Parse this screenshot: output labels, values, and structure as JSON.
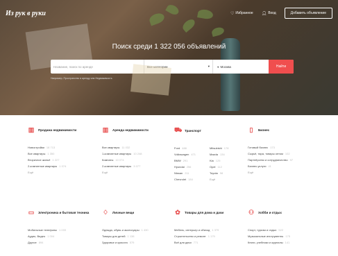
{
  "header": {
    "logo": "Из рук в руки",
    "favorites": "Избранное",
    "login": "Вход",
    "post_ad": "Добавить объявление",
    "favorites_icon": "heart-icon",
    "login_icon": "user-icon"
  },
  "hero": {
    "headline": "Поиск среди 1 322 056 объявлений",
    "search_placeholder": "Название, поиск по аренде",
    "category_selected": "Все категории",
    "location": "Москва",
    "search_button": "Найти",
    "example": "Например, Пространство в аренду или Недвижимость"
  },
  "categories": [
    {
      "title": "Продажа недвижимости",
      "icon": "building-icon",
      "items": [
        {
          "label": "Новостройки",
          "count": "18 713"
        },
        {
          "label": "Все квартиры",
          "count": "1 350"
        },
        {
          "label": "Вторичное жильё",
          "count": "1 227"
        },
        {
          "label": "2-комнатные квартиры",
          "count": "1 074"
        }
      ],
      "more": "Ещё"
    },
    {
      "title": "Аренда недвижимости",
      "icon": "building-icon",
      "items": [
        {
          "label": "Все квартиры",
          "count": "11 032"
        },
        {
          "label": "1-комнатные квартиры",
          "count": "10 248"
        },
        {
          "label": "Комнаты",
          "count": "10 074"
        },
        {
          "label": "2-комнатные квартиры",
          "count": "3 077"
        }
      ],
      "more": "Ещё"
    },
    {
      "title": "Транспорт",
      "icon": "car-icon",
      "items_left": [
        {
          "label": "Ford",
          "count": "488"
        },
        {
          "label": "Volkswagen",
          "count": "471"
        },
        {
          "label": "BMW",
          "count": "291"
        },
        {
          "label": "Hyundai",
          "count": "256"
        },
        {
          "label": "Nissan",
          "count": "211"
        },
        {
          "label": "Chevrolet",
          "count": "184"
        }
      ],
      "items_right": [
        {
          "label": "Mitsubishi",
          "count": "178"
        },
        {
          "label": "Mazda",
          "count": "134"
        },
        {
          "label": "Kia",
          "count": "125"
        },
        {
          "label": "Opel",
          "count": "112"
        },
        {
          "label": "Toyota",
          "count": "98"
        },
        {
          "label": "Ещё",
          "count": ""
        }
      ]
    },
    {
      "title": "Бизнес",
      "icon": "briefcase-icon",
      "items": [
        {
          "label": "Готовый бизнес",
          "count": "173"
        },
        {
          "label": "Сырьё, тара, товары оптом",
          "count": "102"
        },
        {
          "label": "Партнёрство и сотрудничество",
          "count": "97"
        },
        {
          "label": "Бизнес-услуги",
          "count": "41"
        }
      ],
      "more": "Ещё"
    },
    {
      "title": "Электроника и бытовая техника",
      "icon": "phone-icon",
      "items": [
        {
          "label": "Мобильные телефоны",
          "count": "1 033"
        },
        {
          "label": "Аудио, Видео",
          "count": "1 004"
        },
        {
          "label": "Другое",
          "count": "894"
        }
      ]
    },
    {
      "title": "Личные вещи",
      "icon": "shirt-icon",
      "items": [
        {
          "label": "Одежда, обувь и аксессуары",
          "count": "1 430"
        },
        {
          "label": "Товары для детей",
          "count": "1 138"
        },
        {
          "label": "Здоровье и красота",
          "count": "579"
        }
      ]
    },
    {
      "title": "Товары для дома и дачи",
      "icon": "plant-icon",
      "items": [
        {
          "label": "Мебель, интерьер и обиход",
          "count": "1 379"
        },
        {
          "label": "Строительство и ремонт",
          "count": "1 179"
        },
        {
          "label": "Всё для дачи",
          "count": "771"
        }
      ]
    },
    {
      "title": "Хобби и отдых",
      "icon": "bicycle-icon",
      "items": [
        {
          "label": "Спорт, туризм и отдых",
          "count": "522"
        },
        {
          "label": "Музыкальные инструменты",
          "count": "175"
        },
        {
          "label": "Книги, учебники и журналы",
          "count": "141"
        }
      ]
    }
  ]
}
